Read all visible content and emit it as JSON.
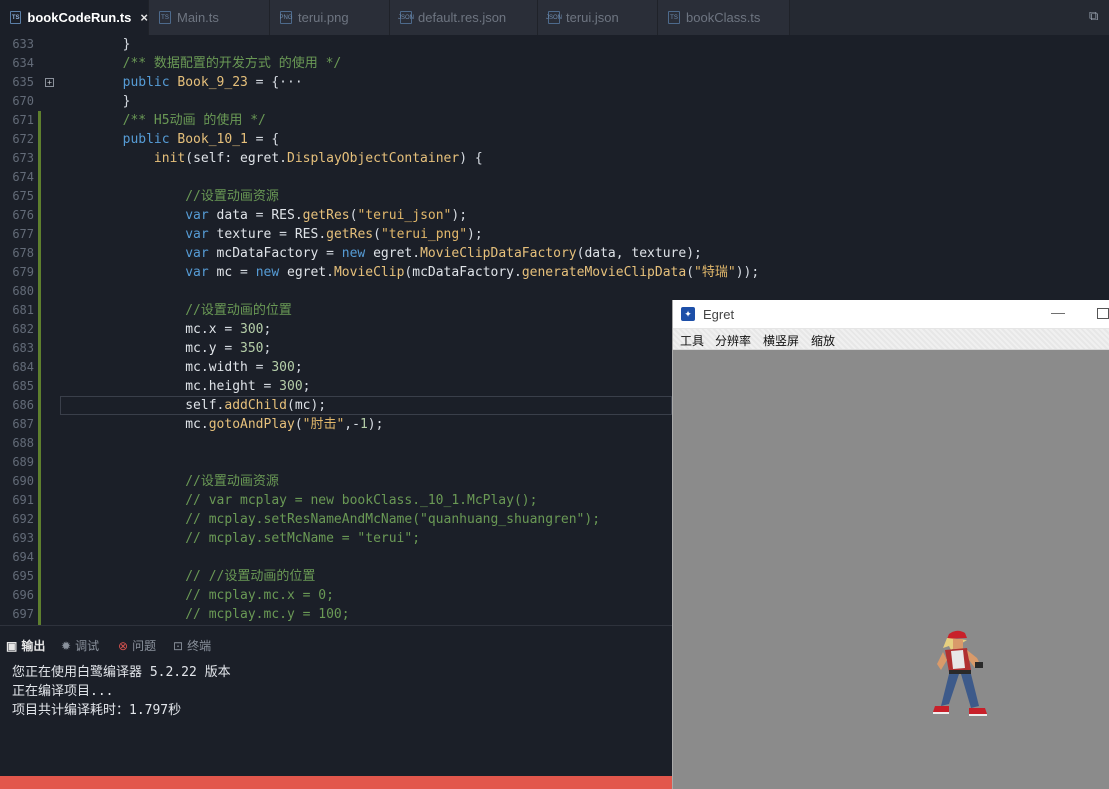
{
  "tabs": [
    {
      "label": "bookCodeRun.ts",
      "icon": "ts-file-icon",
      "active": true
    },
    {
      "label": "Main.ts",
      "icon": "ts-file-icon"
    },
    {
      "label": "terui.png",
      "icon": "png-file-icon"
    },
    {
      "label": "default.res.json",
      "icon": "json-file-icon"
    },
    {
      "label": "terui.json",
      "icon": "json-file-icon"
    },
    {
      "label": "bookClass.ts",
      "icon": "ts-file-icon"
    }
  ],
  "tab_close": "×",
  "editor": {
    "lines": [
      {
        "n": "633",
        "tokens": [
          [
            "p",
            "        }"
          ]
        ]
      },
      {
        "n": "634",
        "tokens": [
          [
            "c",
            "        /** 数据配置的开发方式 的使用 */"
          ]
        ]
      },
      {
        "n": "635",
        "tokens": [
          [
            "k",
            "        public "
          ],
          [
            "t",
            "Book_9_23"
          ],
          [
            "p",
            " = {···"
          ]
        ]
      },
      {
        "n": "670",
        "tokens": [
          [
            "p",
            "        }"
          ]
        ]
      },
      {
        "n": "671",
        "tokens": [
          [
            "c",
            "        /** H5动画 的使用 */"
          ]
        ]
      },
      {
        "n": "672",
        "tokens": [
          [
            "k",
            "        public "
          ],
          [
            "t",
            "Book_10_1"
          ],
          [
            "p",
            " = {"
          ]
        ]
      },
      {
        "n": "673",
        "tokens": [
          [
            "f",
            "            init"
          ],
          [
            "p",
            "("
          ],
          [
            "i",
            "self"
          ],
          [
            "p",
            ": "
          ],
          [
            "i",
            "egret"
          ],
          [
            "p",
            "."
          ],
          [
            "t",
            "DisplayObjectContainer"
          ],
          [
            "p",
            ") {"
          ]
        ]
      },
      {
        "n": "674",
        "tokens": [
          [
            "p",
            ""
          ]
        ]
      },
      {
        "n": "675",
        "tokens": [
          [
            "c",
            "                //设置动画资源"
          ]
        ]
      },
      {
        "n": "676",
        "tokens": [
          [
            "k",
            "                var "
          ],
          [
            "i",
            "data"
          ],
          [
            "p",
            " = "
          ],
          [
            "i",
            "RES"
          ],
          [
            "p",
            "."
          ],
          [
            "f",
            "getRes"
          ],
          [
            "p",
            "("
          ],
          [
            "s",
            "\"terui_json\""
          ],
          [
            "p",
            ");"
          ]
        ]
      },
      {
        "n": "677",
        "tokens": [
          [
            "k",
            "                var "
          ],
          [
            "i",
            "texture"
          ],
          [
            "p",
            " = "
          ],
          [
            "i",
            "RES"
          ],
          [
            "p",
            "."
          ],
          [
            "f",
            "getRes"
          ],
          [
            "p",
            "("
          ],
          [
            "s",
            "\"terui_png\""
          ],
          [
            "p",
            ");"
          ]
        ]
      },
      {
        "n": "678",
        "tokens": [
          [
            "k",
            "                var "
          ],
          [
            "i",
            "mcDataFactory"
          ],
          [
            "p",
            " = "
          ],
          [
            "k",
            "new "
          ],
          [
            "i",
            "egret"
          ],
          [
            "p",
            "."
          ],
          [
            "t",
            "MovieClipDataFactory"
          ],
          [
            "p",
            "("
          ],
          [
            "i",
            "data"
          ],
          [
            "p",
            ", "
          ],
          [
            "i",
            "texture"
          ],
          [
            "p",
            ");"
          ]
        ]
      },
      {
        "n": "679",
        "tokens": [
          [
            "k",
            "                var "
          ],
          [
            "i",
            "mc"
          ],
          [
            "p",
            " = "
          ],
          [
            "k",
            "new "
          ],
          [
            "i",
            "egret"
          ],
          [
            "p",
            "."
          ],
          [
            "t",
            "MovieClip"
          ],
          [
            "p",
            "("
          ],
          [
            "i",
            "mcDataFactory"
          ],
          [
            "p",
            "."
          ],
          [
            "f",
            "generateMovieClipData"
          ],
          [
            "p",
            "("
          ],
          [
            "s",
            "\"特瑞\""
          ],
          [
            "p",
            "));"
          ]
        ]
      },
      {
        "n": "680",
        "tokens": [
          [
            "p",
            ""
          ]
        ]
      },
      {
        "n": "681",
        "tokens": [
          [
            "c",
            "                //设置动画的位置"
          ]
        ]
      },
      {
        "n": "682",
        "tokens": [
          [
            "i",
            "                mc"
          ],
          [
            "p",
            "."
          ],
          [
            "i",
            "x"
          ],
          [
            "p",
            " = "
          ],
          [
            "n",
            "300"
          ],
          [
            "p",
            ";"
          ]
        ]
      },
      {
        "n": "683",
        "tokens": [
          [
            "i",
            "                mc"
          ],
          [
            "p",
            "."
          ],
          [
            "i",
            "y"
          ],
          [
            "p",
            " = "
          ],
          [
            "n",
            "350"
          ],
          [
            "p",
            ";"
          ]
        ]
      },
      {
        "n": "684",
        "tokens": [
          [
            "i",
            "                mc"
          ],
          [
            "p",
            "."
          ],
          [
            "i",
            "width"
          ],
          [
            "p",
            " = "
          ],
          [
            "n",
            "300"
          ],
          [
            "p",
            ";"
          ]
        ]
      },
      {
        "n": "685",
        "tokens": [
          [
            "i",
            "                mc"
          ],
          [
            "p",
            "."
          ],
          [
            "i",
            "height"
          ],
          [
            "p",
            " = "
          ],
          [
            "n",
            "300"
          ],
          [
            "p",
            ";"
          ]
        ]
      },
      {
        "n": "686",
        "tokens": [
          [
            "i",
            "                self"
          ],
          [
            "p",
            "."
          ],
          [
            "f",
            "addChild"
          ],
          [
            "p",
            "("
          ],
          [
            "i",
            "mc"
          ],
          [
            "p",
            ");"
          ]
        ]
      },
      {
        "n": "687",
        "tokens": [
          [
            "i",
            "                mc"
          ],
          [
            "p",
            "."
          ],
          [
            "f",
            "gotoAndPlay"
          ],
          [
            "p",
            "("
          ],
          [
            "s",
            "\"肘击\""
          ],
          [
            "p",
            ",-"
          ],
          [
            "n",
            "1"
          ],
          [
            "p",
            ");"
          ]
        ]
      },
      {
        "n": "688",
        "tokens": [
          [
            "p",
            ""
          ]
        ]
      },
      {
        "n": "689",
        "tokens": [
          [
            "p",
            ""
          ]
        ]
      },
      {
        "n": "690",
        "tokens": [
          [
            "c",
            "                //设置动画资源"
          ]
        ]
      },
      {
        "n": "691",
        "tokens": [
          [
            "c",
            "                // var mcplay = new bookClass._10_1.McPlay();"
          ]
        ]
      },
      {
        "n": "692",
        "tokens": [
          [
            "c",
            "                // mcplay.setResNameAndMcName(\"quanhuang_shuangren\");"
          ]
        ]
      },
      {
        "n": "693",
        "tokens": [
          [
            "c",
            "                // mcplay.setMcName = \"terui\";"
          ]
        ]
      },
      {
        "n": "694",
        "tokens": [
          [
            "p",
            ""
          ]
        ]
      },
      {
        "n": "695",
        "tokens": [
          [
            "c",
            "                // //设置动画的位置"
          ]
        ]
      },
      {
        "n": "696",
        "tokens": [
          [
            "c",
            "                // mcplay.mc.x = 0;"
          ]
        ]
      },
      {
        "n": "697",
        "tokens": [
          [
            "c",
            "                // mcplay.mc.y = 100;"
          ]
        ]
      }
    ],
    "fold_marker": "+"
  },
  "panel": {
    "tabs": [
      {
        "label": "输出",
        "icon": "output-icon",
        "active": true
      },
      {
        "label": "调试",
        "icon": "debug-icon"
      },
      {
        "label": "问题",
        "icon": "problems-icon"
      },
      {
        "label": "终端",
        "icon": "terminal-icon"
      }
    ],
    "output": [
      "您正在使用白鹭编译器 5.2.22 版本",
      "正在编译项目...",
      "项目共计编译耗时：1.797秒"
    ]
  },
  "egret_window": {
    "title": "Egret",
    "menu": [
      "工具",
      "分辨率",
      "横竖屏",
      "缩放"
    ],
    "stage_color": "#8b8b8b"
  },
  "colors": {
    "keyword": "#569cd6",
    "comment": "#6a9955",
    "string": "#e2b86b",
    "type": "#e6c07b",
    "status_bar": "#e2574c"
  }
}
